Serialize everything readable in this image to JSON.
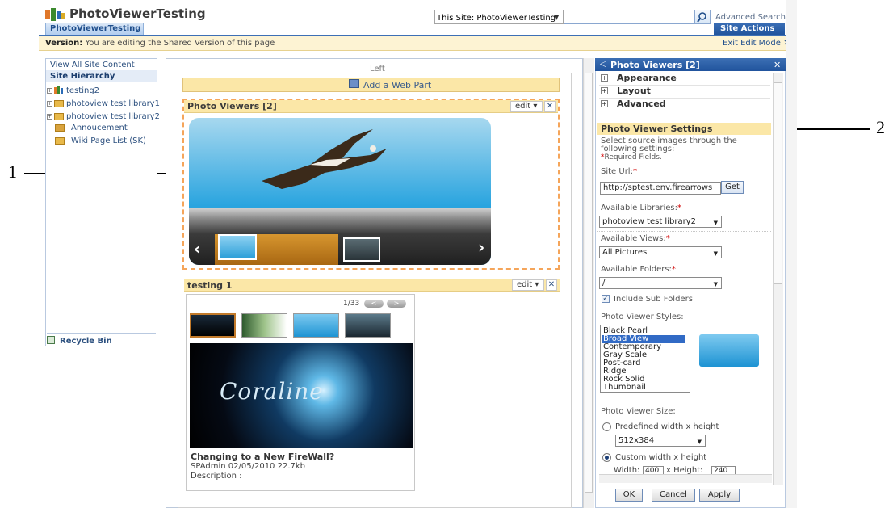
{
  "header": {
    "site_title": "PhotoViewerTesting",
    "site_tab": "PhotoViewerTesting",
    "search_scope": "This Site: PhotoViewerTesting",
    "advanced_search": "Advanced Search",
    "site_actions": "Site Actions ▾"
  },
  "version_bar": {
    "label": "Version:",
    "text": "You are editing the Shared Version of this page",
    "exit": "Exit Edit Mode ✕"
  },
  "leftnav": {
    "view_all": "View All Site Content",
    "hierarchy": "Site Hierarchy",
    "items": [
      "testing2",
      "photoview test library1",
      "photoview test library2",
      "Annoucement",
      "Wiki Page List (SK)"
    ],
    "recycle": "Recycle Bin"
  },
  "zone": {
    "label": "Left",
    "add_web_part": "Add a Web Part",
    "wp1_title": "Photo Viewers [2]",
    "wp2_title": "testing 1",
    "edit": "edit ▾",
    "close": "✕",
    "pager": "1/33",
    "pager_prev": "<",
    "pager_next": ">",
    "coraline": "Coraline",
    "item_title": "Changing to a New FireWall?",
    "item_meta": "SPAdmin 02/05/2010 22.7kb",
    "item_desc": "Description :"
  },
  "toolpane": {
    "title": "Photo Viewers [2]",
    "sections": [
      "Appearance",
      "Layout",
      "Advanced"
    ],
    "settings_title": "Photo Viewer Settings",
    "intro_line1": "Select source images through the",
    "intro_line2": "following settings:",
    "required_note": "Required Fields.",
    "site_url_label": "Site Url:",
    "site_url_value": "http://sptest.env.firearrows",
    "get_button": "Get",
    "libraries_label": "Available Libraries:",
    "libraries_value": "photoview test library2",
    "views_label": "Available Views:",
    "views_value": "All Pictures",
    "folders_label": "Available Folders:",
    "folders_value": "/",
    "include_sub": "Include Sub Folders",
    "styles_label": "Photo Viewer Styles:",
    "styles": [
      "Black Pearl",
      "Broad View",
      "Contemporary",
      "Gray Scale",
      "Post-card",
      "Ridge",
      "Rock Solid",
      "Thumbnail"
    ],
    "selected_style": "Broad View",
    "size_label": "Photo Viewer Size:",
    "predefined": "Predefined width x height",
    "predefined_value": "512x384",
    "custom": "Custom width x height",
    "width_label": "Width:",
    "width_value": "400",
    "height_label": "x Height:",
    "height_value": "240",
    "ok": "OK",
    "cancel": "Cancel",
    "apply": "Apply"
  },
  "callouts": {
    "one": "1",
    "two": "2"
  },
  "colors": {
    "accent_blue": "#21549d",
    "webpart_header": "#fbe7a7",
    "selection_border": "#f5a55a"
  }
}
